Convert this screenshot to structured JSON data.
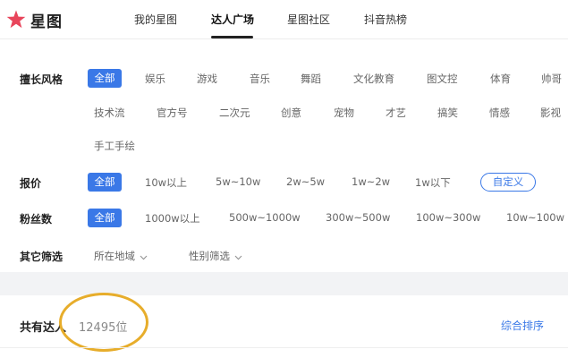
{
  "header": {
    "logo_text": "星图",
    "nav": [
      "我的星图",
      "达人广场",
      "星图社区",
      "抖音热榜"
    ]
  },
  "filters": {
    "style": {
      "label": "擅长风格",
      "active": "全部",
      "row1": [
        "娱乐",
        "游戏",
        "音乐",
        "舞蹈",
        "文化教育",
        "图文控",
        "体育",
        "帅哥"
      ],
      "row2": [
        "技术流",
        "官方号",
        "二次元",
        "创意",
        "宠物",
        "才艺",
        "搞笑",
        "情感",
        "影视"
      ],
      "row3": [
        "手工手绘"
      ]
    },
    "price": {
      "label": "报价",
      "active": "全部",
      "options": [
        "10w以上",
        "5w~10w",
        "2w~5w",
        "1w~2w",
        "1w以下"
      ],
      "custom": "自定义"
    },
    "fans": {
      "label": "粉丝数",
      "active": "全部",
      "options": [
        "1000w以上",
        "500w~1000w",
        "300w~500w",
        "100w~300w",
        "10w~100w"
      ]
    },
    "other": {
      "label": "其它筛选",
      "dropdowns": [
        "所在地域",
        "性别筛选"
      ]
    }
  },
  "results": {
    "count_label": "共有达人",
    "count_value": "12495位",
    "sort_label": "综合排序"
  },
  "colors": {
    "accent": "#3a78e7",
    "logo": "#e8455b",
    "annotation": "#e7ad2b"
  }
}
